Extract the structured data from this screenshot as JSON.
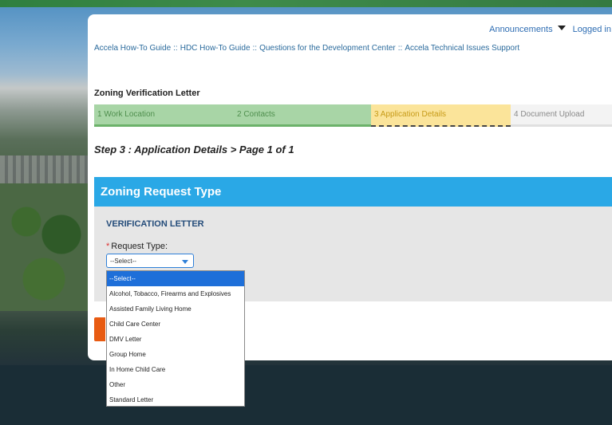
{
  "header": {
    "announcements_label": "Announcements",
    "logged_in_label": "Logged in"
  },
  "breadcrumbs": [
    "Accela How-To Guide",
    "HDC How-To Guide",
    "Questions for the Development Center",
    "Accela Technical Issues Support"
  ],
  "breadcrumb_separator": "::",
  "page": {
    "title": "Zoning Verification Letter",
    "step_heading": "Step 3 : Application Details > Page 1 of 1"
  },
  "steps": [
    {
      "label": "1  Work Location",
      "state": "done"
    },
    {
      "label": "2  Contacts",
      "state": "done"
    },
    {
      "label": "3  Application Details",
      "state": "active"
    },
    {
      "label": "4  Document Upload",
      "state": "todo"
    }
  ],
  "section": {
    "title": "Zoning Request Type",
    "subsection_title": "VERIFICATION LETTER",
    "required_marker": "*",
    "field_label": "Request Type:",
    "selected_value": "--Select--"
  },
  "dropdown_options": [
    "--Select--",
    "Alcohol, Tobacco, Firearms and Explosives",
    "Assisted Family Living Home",
    "Child Care Center",
    "DMV Letter",
    "Group Home",
    "In Home Child Care",
    "Other",
    "Standard Letter"
  ],
  "colors": {
    "section_header": "#2aa8e6",
    "step_done": "#a8d5a6",
    "step_active": "#fbe49a",
    "option_highlight": "#1e6fd9",
    "continue_button": "#e85b12"
  }
}
